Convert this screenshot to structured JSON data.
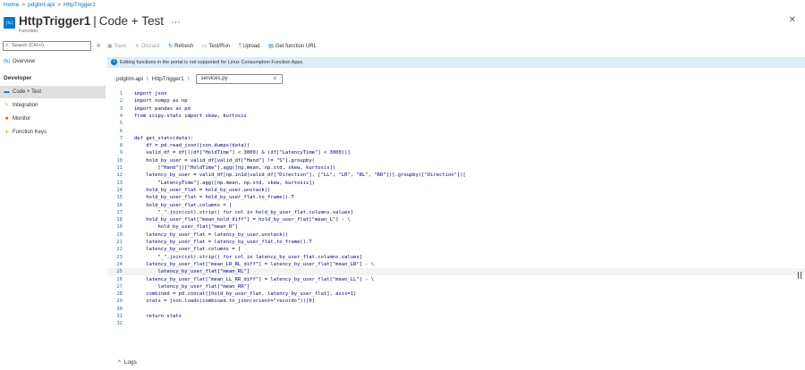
{
  "breadcrumb": [
    "Home",
    "pdglint-api",
    "HttpTrigger1"
  ],
  "header": {
    "icon_text": "{fx}",
    "title_name": "HttpTrigger1",
    "title_sep": "|",
    "title_page": "Code + Test",
    "more": "···",
    "subtitle": "Function",
    "close": "✕"
  },
  "sidebar": {
    "search_placeholder": "Search (Ctrl+/)",
    "collapse": "«",
    "overview": "Overview",
    "section": "Developer",
    "items": [
      {
        "label": "Code + Test",
        "icon": "code-icon"
      },
      {
        "label": "Integration",
        "icon": "integration-icon"
      },
      {
        "label": "Monitor",
        "icon": "monitor-icon"
      },
      {
        "label": "Function Keys",
        "icon": "key-icon"
      }
    ]
  },
  "toolbar": {
    "save": "Save",
    "discard": "Discard",
    "refresh": "Refresh",
    "test_run": "Test/Run",
    "upload": "Upload",
    "get_url": "Get function URL"
  },
  "banner": {
    "text": "Editing functions in the portal is not supported for Linux Consumption Function Apps."
  },
  "path": {
    "app": "pdglint-api",
    "sep": "\\",
    "function": "HttpTrigger1",
    "file": "services.py"
  },
  "editor": {
    "lines": [
      "import json",
      "import numpy as np",
      "import pandas as pd",
      "from scipy.stats import skew, kurtosis",
      "",
      "",
      "def get_stats(data):",
      "    df = pd.read_json(json.dumps(data))",
      "    valid_df = df[((df[\"HoldTime\"] < 3000) & (df[\"LatencyTime\"] < 3000))]",
      "    hold_by_user = valid_df[valid_df[\"Hand\"] != \"S\"].groupby(",
      "        [\"Hand\"])[\"HoldTime\"].agg([np.mean, np.std, skew, kurtosis])",
      "    latency_by_user = valid_df[np.in1d(valid_df[\"Direction\"], [\"LL\", \"LR\", \"RL\", \"RR\"])].groupby([\"Direction\"])[",
      "        \"LatencyTime\"].agg([np.mean, np.std, skew, kurtosis])",
      "    hold_by_user_flat = hold_by_user.unstack()",
      "    hold_by_user_flat = hold_by_user_flat.to_frame().T",
      "    hold_by_user_flat.columns = [",
      "        \"_\".join(col).strip() for col in hold_by_user_flat.columns.values]",
      "    hold_by_user_flat[\"mean_hold_diff\"] = hold_by_user_flat[\"mean_L\"] - \\",
      "        hold_by_user_flat[\"mean_R\"]",
      "    latency_by_user_flat = latency_by_user.unstack()",
      "    latency_by_user_flat = latency_by_user_flat.to_frame().T",
      "    latency_by_user_flat.columns = [",
      "        \"_\".join(col).strip() for col in latency_by_user_flat.columns.values]",
      "    latency_by_user_flat[\"mean_LR_RL_diff\"] = latency_by_user_flat[\"mean_LR\"] - \\",
      "        latency_by_user_flat[\"mean_RL\"]",
      "    latency_by_user_flat[\"mean_LL_RR_diff\"] = latency_by_user_flat[\"mean_LL\"] - \\",
      "        latency_by_user_flat[\"mean_RR\"]",
      "    combined = pd.concat([hold_by_user_flat, latency_by_user_flat], axis=1)",
      "    stats = json.loads(combined.to_json(orient=\"records\"))[0]",
      "",
      "    return stats",
      ""
    ],
    "cursor_line": 25
  },
  "logs": {
    "chevron": "^",
    "label": "Logs"
  }
}
